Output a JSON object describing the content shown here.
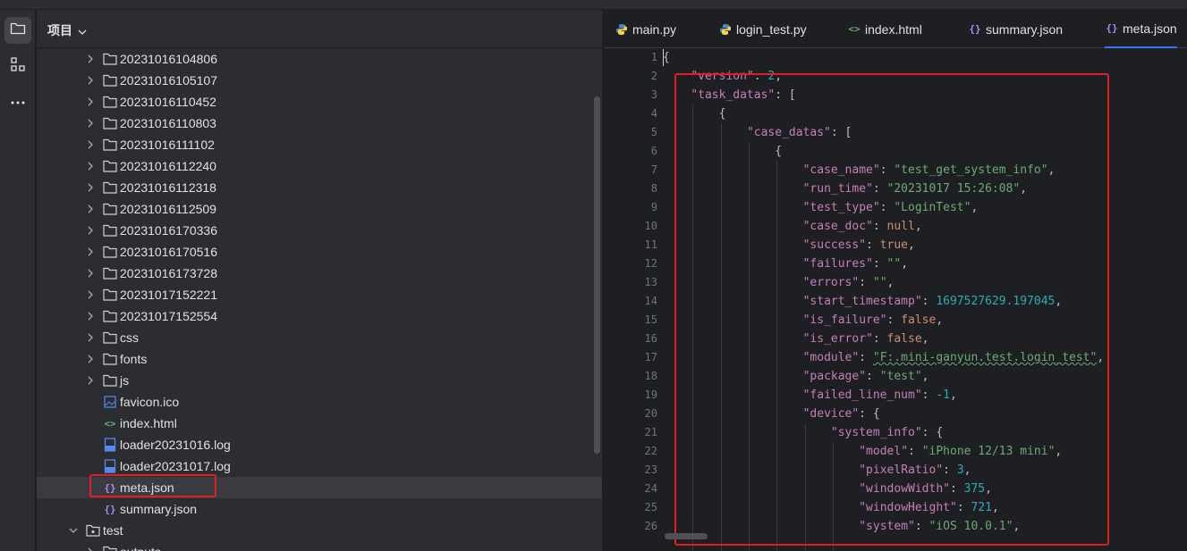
{
  "project_panel": {
    "title": "项目",
    "rows": [
      {
        "label": "20231016104806",
        "icon": "folder"
      },
      {
        "label": "20231016105107",
        "icon": "folder"
      },
      {
        "label": "20231016110452",
        "icon": "folder"
      },
      {
        "label": "20231016110803",
        "icon": "folder"
      },
      {
        "label": "20231016111102",
        "icon": "folder"
      },
      {
        "label": "20231016112240",
        "icon": "folder"
      },
      {
        "label": "20231016112318",
        "icon": "folder"
      },
      {
        "label": "20231016112509",
        "icon": "folder"
      },
      {
        "label": "20231016170336",
        "icon": "folder"
      },
      {
        "label": "20231016170516",
        "icon": "folder"
      },
      {
        "label": "20231016173728",
        "icon": "folder"
      },
      {
        "label": "20231017152221",
        "icon": "folder"
      },
      {
        "label": "20231017152554",
        "icon": "folder"
      },
      {
        "label": "css",
        "icon": "folder"
      },
      {
        "label": "fonts",
        "icon": "folder"
      },
      {
        "label": "js",
        "icon": "folder"
      },
      {
        "label": "favicon.ico",
        "icon": "image-file"
      },
      {
        "label": "index.html",
        "icon": "html-file"
      },
      {
        "label": "loader20231016.log",
        "icon": "log-file"
      },
      {
        "label": "loader20231017.log",
        "icon": "log-file"
      },
      {
        "label": "meta.json",
        "icon": "json-file",
        "selected": true
      },
      {
        "label": "summary.json",
        "icon": "json-file"
      },
      {
        "label": "test",
        "icon": "package-folder",
        "expanded": true
      },
      {
        "label": "outputs",
        "icon": "folder"
      }
    ]
  },
  "editor": {
    "tabs": [
      {
        "label": "main.py",
        "icon": "python-icon"
      },
      {
        "label": "login_test.py",
        "icon": "python-icon"
      },
      {
        "label": "index.html",
        "icon": "html-icon"
      },
      {
        "label": "summary.json",
        "icon": "json-icon"
      },
      {
        "label": "meta.json",
        "icon": "json-icon",
        "active": true
      }
    ],
    "line_numbers": [
      "1",
      "2",
      "3",
      "4",
      "5",
      "6",
      "7",
      "8",
      "9",
      "10",
      "11",
      "12",
      "13",
      "14",
      "15",
      "16",
      "17",
      "18",
      "19",
      "20",
      "21",
      "22",
      "23",
      "24",
      "25",
      "26"
    ],
    "lines": [
      "{",
      "\"version\": 2,",
      "\"task_datas\": [",
      "{",
      "\"case_datas\": [",
      "{",
      "\"case_name\": \"test_get_system_info\",",
      "\"run_time\": \"20231017 15:26:08\",",
      "\"test_type\": \"LoginTest\",",
      "\"case_doc\": null,",
      "\"success\": true,",
      "\"failures\": \"\",",
      "\"errors\": \"\",",
      "\"start_timestamp\": 1697527629.197045,",
      "\"is_failure\": false,",
      "\"is_error\": false,",
      "\"module\": \"F:.mini-ganyun.test.login_test\",",
      "\"package\": \"test\",",
      "\"failed_line_num\": -1,",
      "\"device\": {",
      "\"system_info\": {",
      "\"model\": \"iPhone 12/13 mini\",",
      "\"pixelRatio\": 3,",
      "\"windowWidth\": 375,",
      "\"windowHeight\": 721,",
      "\"system\": \"iOS 10.0.1\","
    ]
  },
  "colors": {
    "highlight_box": "#e02020",
    "json_key": "#c77dbb",
    "json_string": "#6aab73",
    "json_number": "#2aacb8",
    "json_keyword": "#cf8e6d",
    "active_tab_underline": "#3574f0"
  }
}
